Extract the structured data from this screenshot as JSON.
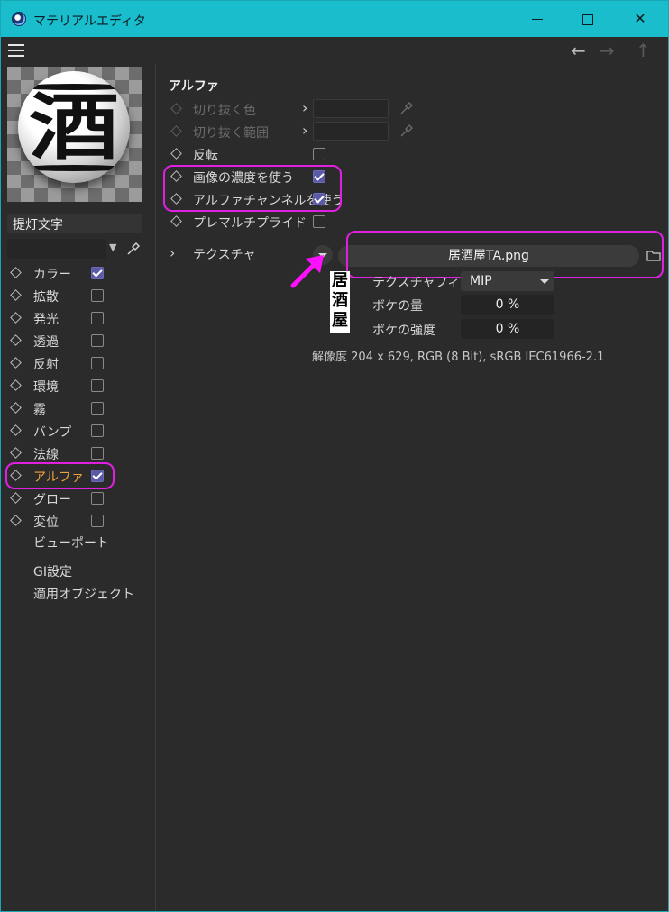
{
  "window": {
    "title": "マテリアルエディタ"
  },
  "colors": {
    "accent": "#19bdcc",
    "highlight": "#e020e0",
    "checkbox": "#5a5aa6",
    "active_channel": "#f0a040"
  },
  "toolbar": {
    "menu_icon": "hamburger-icon",
    "back_icon": "arrow-left-icon",
    "forward_icon": "arrow-right-icon",
    "up_icon": "arrow-up-icon"
  },
  "material": {
    "name": "提灯文字",
    "preview_kanji": "酒",
    "channels": [
      {
        "label": "カラー",
        "checked": true,
        "active": false
      },
      {
        "label": "拡散",
        "checked": false,
        "active": false
      },
      {
        "label": "発光",
        "checked": false,
        "active": false
      },
      {
        "label": "透過",
        "checked": false,
        "active": false
      },
      {
        "label": "反射",
        "checked": false,
        "active": false
      },
      {
        "label": "環境",
        "checked": false,
        "active": false
      },
      {
        "label": "霧",
        "checked": false,
        "active": false
      },
      {
        "label": "バンプ",
        "checked": false,
        "active": false
      },
      {
        "label": "法線",
        "checked": false,
        "active": false
      },
      {
        "label": "アルファ",
        "checked": true,
        "active": true
      },
      {
        "label": "グロー",
        "checked": false,
        "active": false
      },
      {
        "label": "変位",
        "checked": false,
        "active": false
      }
    ],
    "extra_items": [
      "ビューポート",
      "GI設定",
      "適用オブジェクト"
    ]
  },
  "alpha": {
    "section_title": "アルファ",
    "cutout_color_label": "切り抜く色",
    "cutout_range_label": "切り抜く範囲",
    "invert_label": "反転",
    "invert_checked": false,
    "image_density_label": "画像の濃度を使う",
    "image_density_checked": true,
    "alpha_channel_label": "アルファチャンネルを使う",
    "alpha_channel_checked": true,
    "premultiplied_label": "プレマルチプライド",
    "premultiplied_checked": false,
    "texture_label": "テクスチャ",
    "texture_file": "居酒屋TA.png",
    "texture_thumb_chars": [
      "居",
      "酒",
      "屋"
    ],
    "filter_label": "テクスチャフィルタ",
    "filter_value": "MIP",
    "blur_amount_label": "ボケの量",
    "blur_amount_value": "0 %",
    "blur_strength_label": "ボケの強度",
    "blur_strength_value": "0 %",
    "resolution_info": "解像度 204 x 629, RGB (8 Bit), sRGB IEC61966-2.1"
  }
}
